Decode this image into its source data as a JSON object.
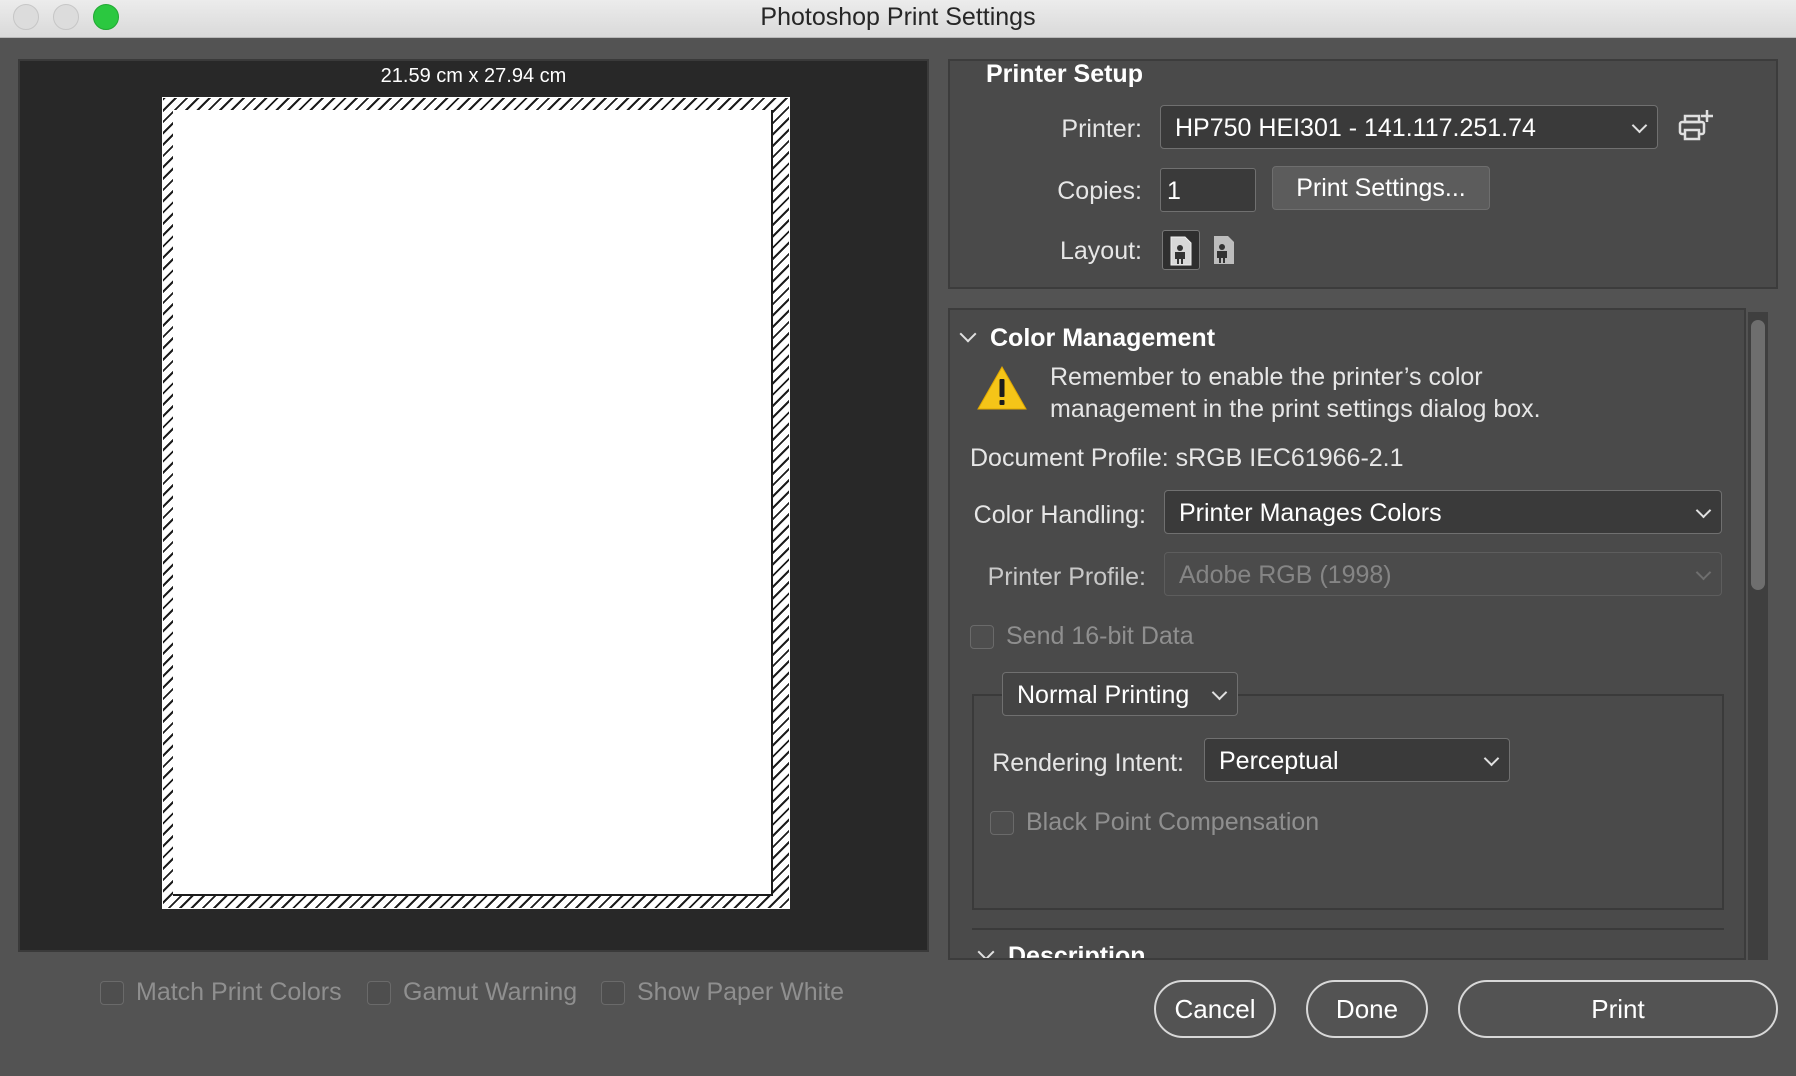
{
  "window": {
    "title": "Photoshop Print Settings"
  },
  "preview": {
    "paper_size": "21.59 cm x 27.94 cm"
  },
  "preview_options": {
    "match_print_colors": "Match Print Colors",
    "gamut_warning": "Gamut Warning",
    "show_paper_white": "Show Paper White"
  },
  "printer_setup": {
    "title": "Printer Setup",
    "printer_label": "Printer:",
    "printer_value": "HP750 HEI301 - 141.117.251.74",
    "copies_label": "Copies:",
    "copies_value": "1",
    "print_settings_button": "Print Settings...",
    "layout_label": "Layout:"
  },
  "color_management": {
    "title": "Color Management",
    "warning_line1": "Remember to enable the printer’s color",
    "warning_line2": "management in the print settings dialog box.",
    "document_profile": "Document Profile: sRGB IEC61966-2.1",
    "color_handling_label": "Color Handling:",
    "color_handling_value": "Printer Manages Colors",
    "printer_profile_label": "Printer Profile:",
    "printer_profile_value": "Adobe RGB (1998)",
    "send_16bit": "Send 16-bit Data",
    "printing_mode": "Normal Printing",
    "rendering_intent_label": "Rendering Intent:",
    "rendering_intent_value": "Perceptual",
    "black_point": "Black Point Compensation"
  },
  "description": {
    "title": "Description"
  },
  "buttons": {
    "cancel": "Cancel",
    "done": "Done",
    "print": "Print"
  },
  "colors": {
    "accent_green": "#2bc840",
    "warning_yellow": "#f5c518",
    "panel_bg": "#4a4a4a"
  }
}
